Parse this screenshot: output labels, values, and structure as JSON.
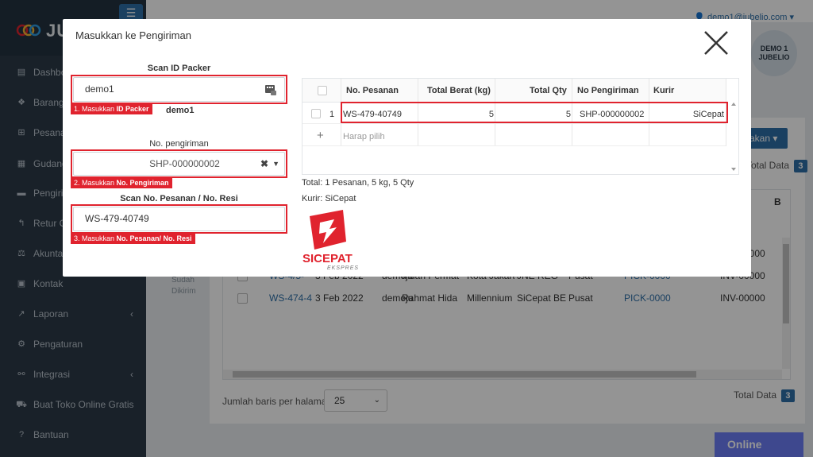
{
  "sidebar": {
    "brand": "JU",
    "toggle": "☰",
    "items": [
      {
        "label": "Dashboard",
        "icon": "chart-icon",
        "glyph": "▤",
        "chevron": ""
      },
      {
        "label": "Barang",
        "icon": "cubes-icon",
        "glyph": "❖",
        "chevron": ""
      },
      {
        "label": "Pesanan",
        "icon": "basket-icon",
        "glyph": "⊞",
        "chevron": ""
      },
      {
        "label": "Gudang",
        "icon": "building-icon",
        "glyph": "▦",
        "chevron": ""
      },
      {
        "label": "Pengiriman",
        "icon": "truck-icon",
        "glyph": "▬",
        "chevron": ""
      },
      {
        "label": "Retur Order",
        "icon": "reply-icon",
        "glyph": "↰",
        "chevron": ""
      },
      {
        "label": "Akuntansi",
        "icon": "balance-icon",
        "glyph": "⚖",
        "chevron": ""
      },
      {
        "label": "Kontak",
        "icon": "contact-card-icon",
        "glyph": "▣",
        "chevron": ""
      },
      {
        "label": "Laporan",
        "icon": "line-chart-icon",
        "glyph": "↗",
        "chevron": "‹"
      },
      {
        "label": "Pengaturan",
        "icon": "gears-icon",
        "glyph": "⚙",
        "chevron": ""
      },
      {
        "label": "Integrasi",
        "icon": "sitemap-icon",
        "glyph": "⚯",
        "chevron": "‹"
      },
      {
        "label": "Buat Toko Online Gratis",
        "icon": "cart-icon",
        "glyph": "⛟",
        "chevron": ""
      },
      {
        "label": "Bantuan",
        "icon": "question-icon",
        "glyph": "?",
        "chevron": ""
      }
    ]
  },
  "topbar": {
    "user_email": "👤 demo1@jubelio.com ▾",
    "avatar_text": "DEMO 1\nJUBELIO"
  },
  "background": {
    "dropdown_label": "akan ▾",
    "total_label": "Total Data",
    "total_count": "3",
    "col_b": "B",
    "sudah_dikirim": "Sudah\nDikirim",
    "rows": [
      {
        "no": "",
        "date": "",
        "store": "",
        "customer": "",
        "city": "",
        "courier": "",
        "origin": "",
        "pick": "0000",
        "inv": "INV-00000"
      },
      {
        "no": "WS-4/5-",
        "date": "3 Feb 2022",
        "store": "demoju",
        "customer": "Indah Permat",
        "city": "Kota Jakarta",
        "courier": "JNE REG",
        "origin": "Pusat",
        "pick": "PICK-0000",
        "inv": "INV-00000"
      },
      {
        "no": "WS-474-4",
        "date": "3 Feb 2022",
        "store": "demoju",
        "customer": "Rahmat Hida",
        "city": "Millennium C",
        "courier": "SiCepat BES",
        "origin": "Pusat",
        "pick": "PICK-0000",
        "inv": "INV-00000"
      }
    ],
    "rows_per_page_label": "Jumlah baris per halaman",
    "rows_per_page_value": "25",
    "total_label_2": "Total Data",
    "total_count_2": "3",
    "online_label": "Online"
  },
  "modal": {
    "title": "Masukkan ke Pengiriman",
    "packer": {
      "label": "Scan ID Packer",
      "value": "demo1",
      "hint_prefix": "1. Masukkan ",
      "hint_bold": "ID Packer",
      "packer_name": "demo1"
    },
    "shipment": {
      "label": "No. pengiriman",
      "value": "SHP-000000002",
      "hint_prefix": "2. Masukkan ",
      "hint_bold": "No. Pengiriman"
    },
    "order": {
      "label": "Scan No. Pesanan / No. Resi",
      "value": "WS-479-40749",
      "hint_prefix": "3. Masukkan ",
      "hint_bold": "No. Pesanan/ No. Resi"
    },
    "grid": {
      "headers": [
        "No. Pesanan",
        "Total Berat (kg)",
        "Total Qty",
        "No Pengiriman",
        "Kurir"
      ],
      "rows": [
        {
          "index": "1",
          "order_no": "WS-479-40749",
          "weight": "5",
          "qty": "5",
          "shipment_no": "SHP-000000002",
          "courier": "SiCepat"
        }
      ],
      "add_symbol": "+",
      "add_placeholder": "Harap pilih"
    },
    "summary": "Total: 1 Pesanan, 5 kg, 5 Qty",
    "courier_text": "Kurir: SiCepat",
    "logo": {
      "text": "SICEPAT",
      "subtext": "EKSPRES",
      "color": "#e0232e"
    }
  },
  "colors": {
    "accent": "#2e6fa7",
    "highlight_red": "#e0232e",
    "sidebar_bg": "#2b3a47",
    "online_btn": "#6c7df5"
  }
}
